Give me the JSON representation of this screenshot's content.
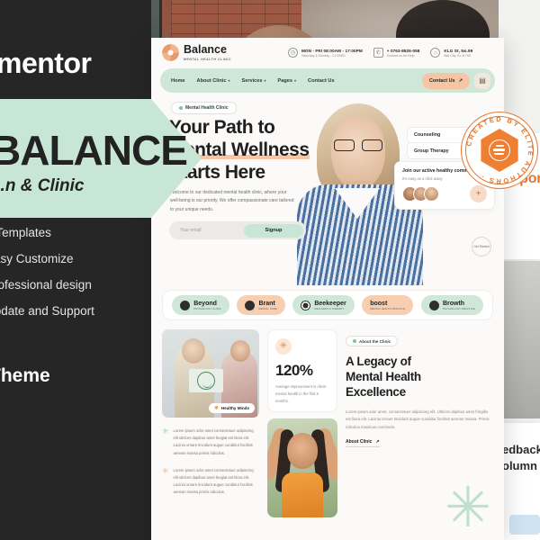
{
  "promo": {
    "brand_word": "mentor",
    "title": "BALANCE",
    "subtitle": "...n & Clinic",
    "features": [
      "+ Templates",
      "Easy Customize",
      "Professional design",
      "Update and Support"
    ],
    "theme_word": "Theme"
  },
  "badge_stamp": {
    "text": "CREATED BY ELITE AUTHORS",
    "color": "#e4762e"
  },
  "right_panels": {
    "support_partial": "upport",
    "feedback_partial": "edback",
    "volume_partial": "olumn"
  },
  "site": {
    "logo": {
      "name": "Balance",
      "tagline": "MENTAL HEALTH CLINIC"
    },
    "topinfo": [
      {
        "icon": "clock-icon",
        "title": "MON - FRI 08:00AM - 17:00PM",
        "sub": "Saturday & Sunday - CLOSED"
      },
      {
        "icon": "phone-icon",
        "title": "+ 0763-8525-058",
        "sub": "Contact us for Help"
      },
      {
        "icon": "location-icon",
        "title": "KLG St, No.99",
        "sub": "Mai City, ID 41795"
      }
    ],
    "nav": {
      "links": [
        {
          "label": "Home",
          "caret": false
        },
        {
          "label": "About Clinic",
          "caret": true
        },
        {
          "label": "Services",
          "caret": true
        },
        {
          "label": "Pages",
          "caret": true
        },
        {
          "label": "Contact Us",
          "caret": false
        }
      ],
      "cta": "Contact Us",
      "cta_arrow": "↗",
      "burger_icon": "grid-menu-icon"
    },
    "hero": {
      "badge": "Mental Health Clinic",
      "title_line1": "Your Path to",
      "title_line2": "Mental Wellness",
      "title_line3": "Starts Here",
      "paragraph": "Welcome to our dedicated mental health clinic, where your well-being is our priority. We offer compassionate care tailored to your unique needs.",
      "email_placeholder": "Your email",
      "signup_label": "Signup",
      "scroll_label": "Get Started",
      "accordion": [
        {
          "label": "Counseling",
          "caret": "›"
        },
        {
          "label": "Group Therapy",
          "caret": "↗"
        }
      ],
      "community": {
        "title": "Join our active healthy community",
        "subtitle": "It's easy as a click away",
        "plus": "+"
      }
    },
    "brands": [
      {
        "name": "Beyond",
        "sub": "PSYCHOLOGY CLINIC",
        "style": "green",
        "icon": "beyond-mark"
      },
      {
        "name": "Brant",
        "sub": "MENTAL CARE",
        "style": "peach",
        "icon": "brant-mark"
      },
      {
        "name": "Beekeeper",
        "sub": "WELLNESS & THERAPY",
        "style": "green",
        "icon": "beekeeper-mark"
      },
      {
        "name": "boost",
        "sub": "MENTAL HEALTH PRACTICE",
        "style": "peach",
        "icon": "boost-mark"
      },
      {
        "name": "Browth",
        "sub": "PSYCHOLOGY PRACTICE",
        "style": "green",
        "icon": "browth-mark"
      }
    ],
    "therapy_card": {
      "badge": "Healthy Minds",
      "bullets": [
        "Lorem ipsum odor amet consectetuer adipiscing elit ultrices dapibus amet feugiat est litora elit. Lacinia ornare tincidunt augue curabitur facilisis aenean massa primis ridiculus.",
        "Lorem ipsum odor amet consectetuer adipiscing elit ultrices dapibus amet feugiat est litora elit. Lacinia ornare tincidunt augue curabitur facilisis aenean massa primis ridiculus."
      ]
    },
    "stat": {
      "icon": "asterisk-icon",
      "value": "120%",
      "description": "Average improvement in client mental health in the first 6 months."
    },
    "about": {
      "badge": "About the Clinic",
      "heading_l1": "A Legacy of",
      "heading_l2": "Mental Health",
      "heading_l3": "Excellence",
      "paragraph": "Lorem ipsum odor amet, consectetuer adipiscing elit. Ultrices dapibus amet fringilla est litora elit. Lacinia ornare tincidunt augue curabitur facilisis aenean massa. Primis ridiculus maximus commodo.",
      "button": "About Clinic",
      "button_arrow": "↗"
    }
  }
}
